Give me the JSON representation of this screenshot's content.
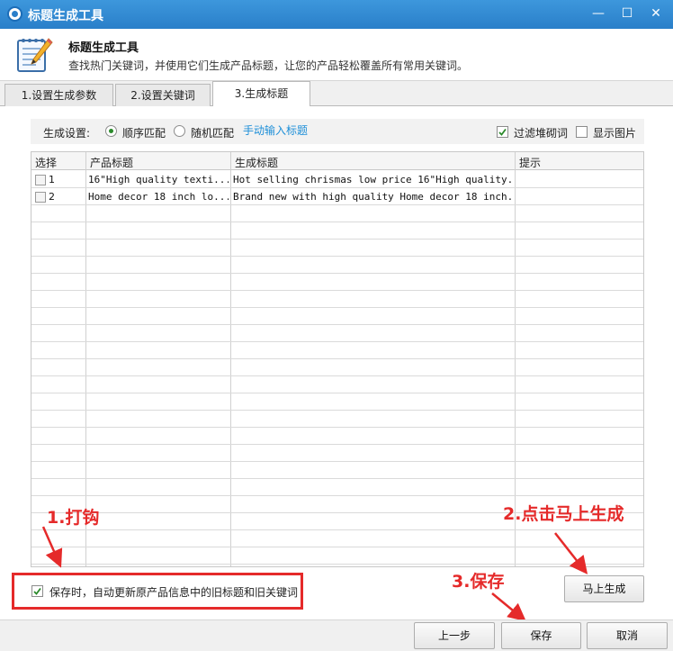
{
  "window": {
    "title": "标题生成工具",
    "minimize_glyph": "—",
    "maximize_glyph": "☐",
    "close_glyph": "✕"
  },
  "header": {
    "title": "标题生成工具",
    "description": "查找热门关键词，并使用它们生成产品标题，让您的产品轻松覆盖所有常用关键词。",
    "icon": "notebook-pencil-icon"
  },
  "tabs": [
    {
      "label": "1.设置生成参数",
      "active": false
    },
    {
      "label": "2.设置关键词",
      "active": false
    },
    {
      "label": "3.生成标题",
      "active": true
    }
  ],
  "settings": {
    "label": "生成设置:",
    "options": [
      {
        "label": "顺序匹配",
        "selected": true
      },
      {
        "label": "随机匹配",
        "selected": false
      }
    ],
    "manual_link": "手动输入标题",
    "filter_stopwords": {
      "label": "过滤堆砌词",
      "checked": true
    },
    "show_images": {
      "label": "显示图片",
      "checked": false
    }
  },
  "table": {
    "columns": [
      "选择",
      "产品标题",
      "生成标题",
      "提示"
    ],
    "rows": [
      {
        "index": "1",
        "checked": false,
        "product_title": "16\"High quality texti...",
        "generated_title": "Hot selling chrismas low price 16\"High quality...",
        "hint": ""
      },
      {
        "index": "2",
        "checked": false,
        "product_title": "Home decor 18 inch lo...",
        "generated_title": "Brand new with high quality Home decor 18 inch...",
        "hint": ""
      }
    ]
  },
  "save_option": {
    "label": "保存时，自动更新原产品信息中的旧标题和旧关键词",
    "checked": true
  },
  "annotations": {
    "step1": "1.打钩",
    "step2": "2.点击马上生成",
    "step3": "3.保存",
    "color": "#e52a2a"
  },
  "buttons": {
    "generate": "马上生成",
    "prev": "上一步",
    "save": "保存",
    "cancel": "取消"
  },
  "colors": {
    "titlebar": "#2a7fc9",
    "link": "#1d8fd8",
    "check": "#2b8a2b"
  }
}
